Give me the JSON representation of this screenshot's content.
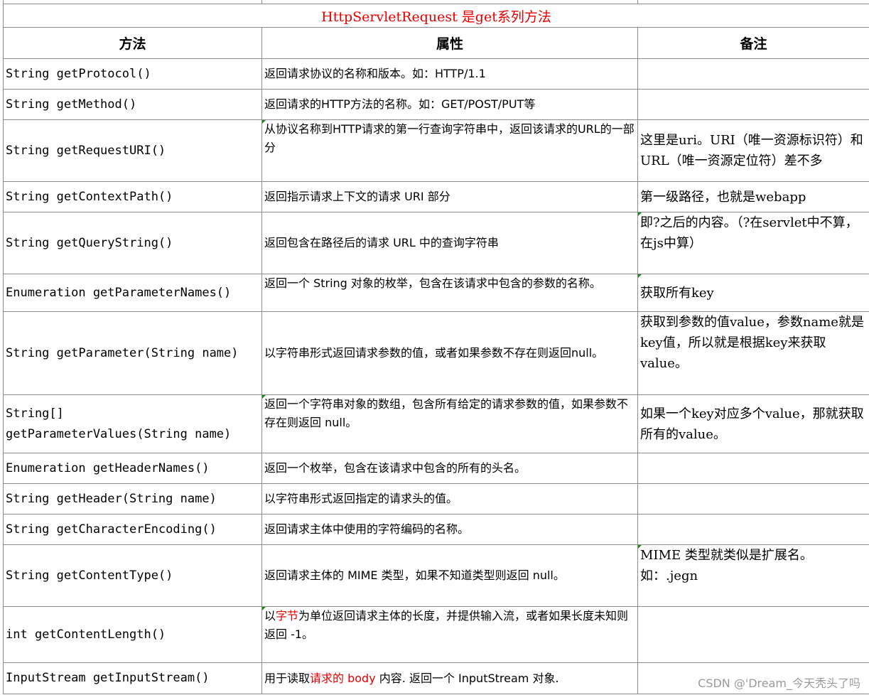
{
  "title": "HttpServletRequest 是get系列方法",
  "headers": {
    "method": "方法",
    "attr": "属性",
    "note": "备注"
  },
  "rows": [
    {
      "method": "String getProtocol()",
      "desc": "返回请求协议的名称和版本。如：HTTP/1.1",
      "note": ""
    },
    {
      "method": "String getMethod()",
      "desc": "返回请求的HTTP方法的名称。如：GET/POST/PUT等",
      "note": ""
    },
    {
      "method": "String getRequestURI()",
      "desc": "从协议名称到HTTP请求的第一行查询字符串中，返回该请求的URL的一部分",
      "note": "这里是uri。URI（唯一资源标识符）和URL（唯一资源定位符）差不多"
    },
    {
      "method": "String getContextPath()",
      "desc": "返回指示请求上下文的请求 URI 部分",
      "note": "第一级路径，也就是webapp"
    },
    {
      "method": "String getQueryString()",
      "desc": "返回包含在路径后的请求 URL 中的查询字符串",
      "note": "即?之后的内容。（?在servlet中不算，在js中算）"
    },
    {
      "method": "Enumeration getParameterNames()",
      "desc": "返回一个 String 对象的枚举，包含在该请求中包含的参数的名称。",
      "note": "获取所有key"
    },
    {
      "method": "String getParameter(String name)",
      "desc": "以字符串形式返回请求参数的值，或者如果参数不存在则返回null。",
      "note": "获取到参数的值value，参数name就是key值，所以就是根据key来获取value。"
    },
    {
      "method": "String[]\ngetParameterValues(String name)",
      "desc": "返回一个字符串对象的数组，包含所有给定的请求参数的值，如果参数不存在则返回 null。",
      "note": "如果一个key对应多个value，那就获取所有的value。"
    },
    {
      "method": "Enumeration getHeaderNames()",
      "desc": "返回一个枚举，包含在该请求中包含的所有的头名。",
      "note": ""
    },
    {
      "method": "String getHeader(String name)",
      "desc": "以字符串形式返回指定的请求头的值。",
      "note": ""
    },
    {
      "method": "String getCharacterEncoding()",
      "desc": "返回请求主体中使用的字符编码的名称。",
      "note": ""
    },
    {
      "method": "String getContentType()",
      "desc": "返回请求主体的 MIME 类型，如果不知道类型则返回 null。",
      "note": " MIME 类型就类似是扩展名。如：.jegn"
    },
    {
      "method": "int getContentLength()",
      "desc_pre": "以",
      "desc_red": "字节",
      "desc_post": "为单位返回请求主体的长度，并提供输入流，或者如果长度未知则返回 -1。",
      "note": ""
    },
    {
      "method": "InputStream getInputStream()",
      "desc_pre": "用于读取",
      "desc_red": "请求的 body",
      "desc_post": " 内容. 返回一个 InputStream 对象.",
      "note": ""
    }
  ],
  "watermark": "CSDN @'Dream_今天秃头了吗"
}
